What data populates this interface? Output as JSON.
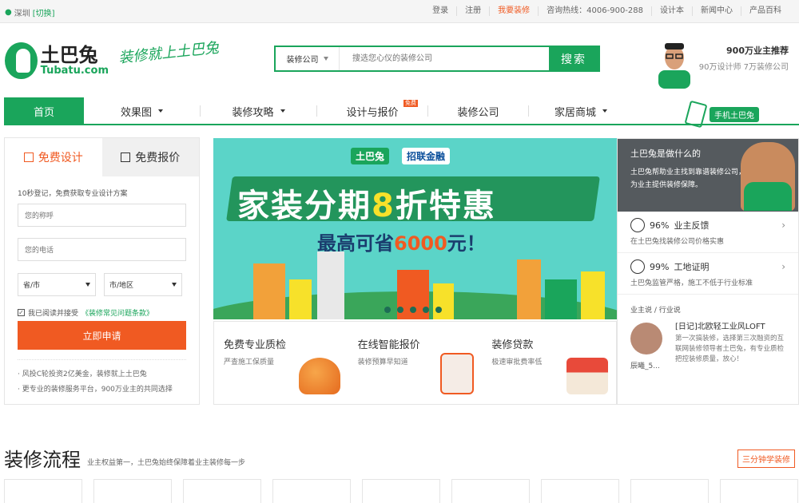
{
  "topbar": {
    "city": "深圳",
    "switch": "[切换]",
    "links": [
      "登录",
      "注册",
      "我要装修",
      "咨询热线：4006-900-288",
      "设计本",
      "新闻中心",
      "产品百科"
    ]
  },
  "logo": {
    "cn": "土巴兔",
    "en": "Tubatu.com",
    "slogan": "装修就上土巴兔"
  },
  "search": {
    "category": "装修公司",
    "placeholder": "搜选您心仪的装修公司",
    "button": "搜索"
  },
  "recommend": {
    "line1": "900万业主推荐",
    "line2": "90万设计师 7万装修公司"
  },
  "nav": {
    "items": [
      "首页",
      "效果图",
      "装修攻略",
      "设计与报价",
      "装修公司",
      "家居商城"
    ],
    "hot": "免费",
    "mobile": "手机土巴兔"
  },
  "form": {
    "tab1": "免费设计",
    "tab2": "免费报价",
    "tip": "10秒登记，免费获取专业设计方案",
    "name_ph": "您的称呼",
    "phone_ph": "您的电话",
    "province": "省/市",
    "city": "市/地区",
    "agree": "我已阅读并接受",
    "agree_link": "《装修常见问题条款》",
    "submit": "立即申请",
    "notes": [
      "风投C轮投资2亿美金，装修就上土巴兔",
      "更专业的装修服务平台，900万业主的共同选择"
    ]
  },
  "banner": {
    "brand1": "土巴兔",
    "brand2": "招联金融",
    "title_a": "家装分期",
    "title_8": "8",
    "title_b": "折特惠",
    "sub_a": "最高可省",
    "sub_num": "6000",
    "sub_b": "元！"
  },
  "features": [
    {
      "title": "免费专业质检",
      "desc": "严查施工保质量"
    },
    {
      "title": "在线智能报价",
      "desc": "装修预算早知道"
    },
    {
      "title": "装修贷款",
      "desc": "极速审批费率低"
    }
  ],
  "about": {
    "question": "土巴兔是做什么的",
    "desc1": "土巴兔帮助业主找到靠谱装修公司，",
    "desc2": "为业主提供装修保障。"
  },
  "stats": [
    {
      "value": "96%",
      "label": "业主反馈",
      "desc": "在土巴兔找装修公司价格实惠"
    },
    {
      "value": "99%",
      "label": "工地证明",
      "desc": "土巴兔监管严格，施工不低于行业标准"
    }
  ],
  "say": {
    "label": "业主说 / 行业说",
    "name": "辰曦_5...",
    "title": "[日记]北欧轻工业风LOFT",
    "desc": "第一次搞装修，选择第三次融资的互联网装修领导者土巴兔，有专业质检把控装修质量，放心！"
  },
  "section": {
    "title": "装修流程",
    "sub": "业主权益第一，土巴兔始终保障着业主装修每一步",
    "btn": "三分钟学装修"
  },
  "colors": {
    "brand": "#1aa55b",
    "accent": "#f05a22"
  }
}
